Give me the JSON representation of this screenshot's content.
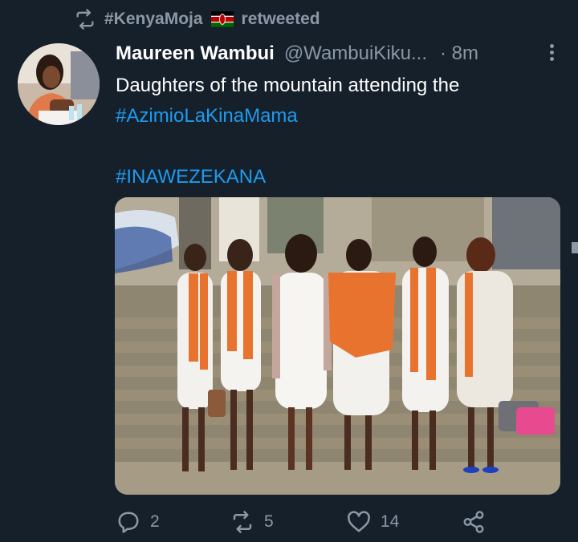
{
  "retweet_banner": {
    "account": "#KenyaMoja",
    "action": "retweeted",
    "icon": "retweet-icon"
  },
  "tweet": {
    "author_name": "Maureen Wambui",
    "author_handle": "@WambuiKiku...",
    "time": "· 8m",
    "text_line1": "Daughters of the mountain attending the",
    "hashtag1": "#AzimioLaKinaMama",
    "hashtag2": "#INAWEZEKANA"
  },
  "actions": {
    "replies": "2",
    "retweets": "5",
    "likes": "14"
  },
  "colors": {
    "background": "#15202b",
    "muted": "#8b98a5",
    "link": "#1d9bf0",
    "scarf": "#e8732f"
  }
}
